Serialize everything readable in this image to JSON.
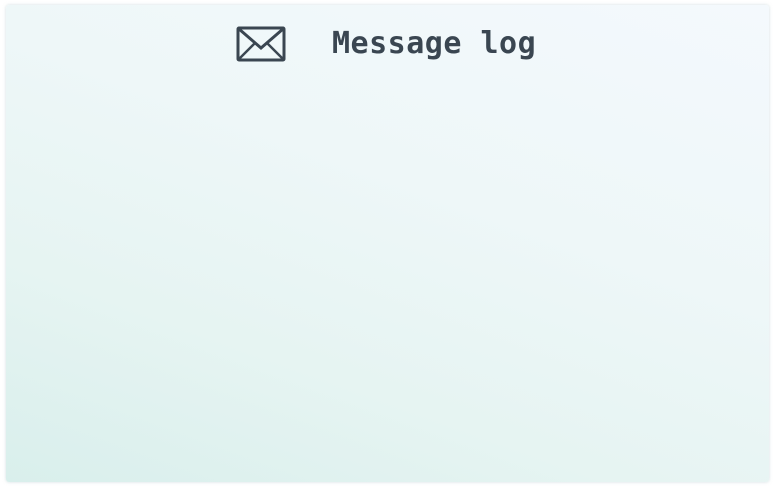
{
  "header": {
    "icon": "envelope-icon",
    "title": "Message log"
  },
  "log": {
    "messages": []
  },
  "colors": {
    "title_text": "#3a4651",
    "icon_stroke": "#3a4651",
    "panel_background_start": "#d9efec",
    "panel_background_end": "#f4f9fd"
  }
}
